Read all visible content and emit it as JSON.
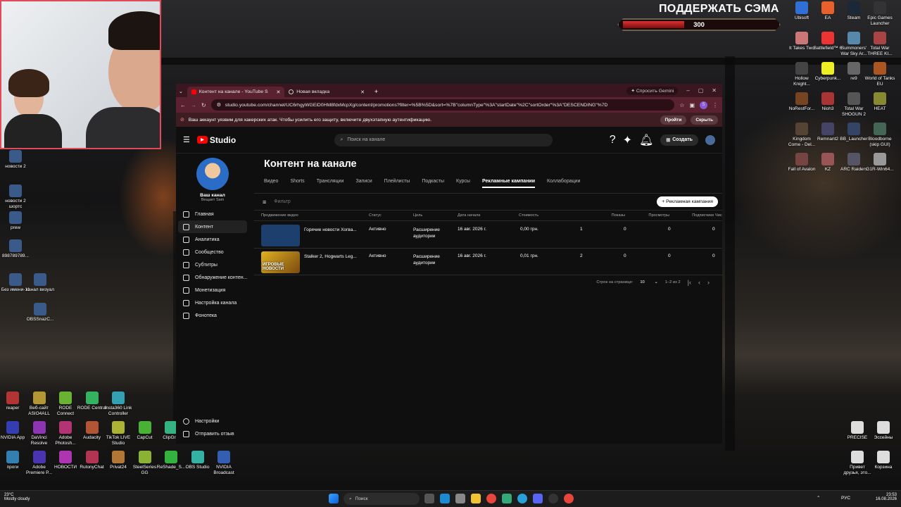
{
  "overlay": {
    "support_text": "ПОДДЕРЖАТЬ СЭМА",
    "bar_value": "300",
    "bar_fill": 0.38
  },
  "browser": {
    "tabs": [
      {
        "label": "Контент на канале - YouTube S"
      },
      {
        "label": "Новая вкладка"
      }
    ],
    "ask_gemini": "Спросить Gemini",
    "url": "studio.youtube.com/channel/UC6rhgyWGEiD0HM8fdxMcpXg/content/promotions?filter=%5B%5D&sort=%7B\"columnType\"%3A\"startDate\"%2C\"sortOrder\"%3A\"DESCENDING\"%7D",
    "profile_letter": "S",
    "warning": {
      "text": "Ваш аккаунт уязвим для хакерских атак. Чтобы усилить его защиту, включите двухэтапную аутентификацию.",
      "go": "Пройти",
      "hide": "Скрыть"
    }
  },
  "studio": {
    "logo": "Studio",
    "search_placeholder": "Поиск на канале",
    "create": "Создать",
    "channel": {
      "name": "Ваш канал",
      "handle": "Вещает Sam"
    },
    "nav": [
      "Главная",
      "Контент",
      "Аналитика",
      "Сообщество",
      "Субтитры",
      "Обнаружение контен...",
      "Монетизация",
      "Настройка канала",
      "Фонотека"
    ],
    "nav_bottom": [
      "Настройки",
      "Отправить отзыв"
    ],
    "page_title": "Контент на канале",
    "tabs": [
      "Видео",
      "Shorts",
      "Трансляции",
      "Записи",
      "Плейлисты",
      "Подкасты",
      "Курсы",
      "Рекламные кампании",
      "Коллаборации"
    ],
    "active_tab": 7,
    "filter_placeholder": "Фильтр",
    "campaign_button": "+ Рекламная кампания",
    "columns": [
      "Продвижение видео",
      "Статус",
      "Цель",
      "Дата начала",
      "Стоимость",
      "Показы",
      "Просмотры",
      "Подписчики",
      "Число последующ..."
    ],
    "rows": [
      {
        "video": "Горячие новости Хогва...",
        "status": "Активно",
        "goal": "Расширение аудитории",
        "date": "16 авг. 2026 г.",
        "cost": "0,00 грн.",
        "impr": "1",
        "views": "0",
        "subs": "0",
        "next": "0",
        "thumb": "#1d3f6e"
      },
      {
        "video": "Stalker 2, Hogwarts Leg...",
        "status": "Активно",
        "goal": "Расширение аудитории",
        "date": "16 авг. 2026 г.",
        "cost": "0,01 грн.",
        "impr": "2",
        "views": "0",
        "subs": "0",
        "next": "0",
        "thumb": "#b8860b",
        "thumb_text": "ИГРОВЫЕ НОВОСТИ"
      }
    ],
    "pager": {
      "label": "Строк на странице:",
      "size": "10",
      "range": "1–2 из 2"
    }
  },
  "desktop_icons": {
    "right": [
      {
        "label": "Ubisoft",
        "color": "#2f6fd6"
      },
      {
        "label": "EA",
        "color": "#e8612c"
      },
      {
        "label": "Steam",
        "color": "#1b2838"
      },
      {
        "label": "Epic Games Launcher",
        "color": "#333"
      },
      {
        "label": "It Takes Two",
        "color": "#c77"
      },
      {
        "label": "Battlefield™ 6",
        "color": "#e33"
      },
      {
        "label": "Summoners' War Sky Ar...",
        "color": "#58a"
      },
      {
        "label": "Total War THREE KI...",
        "color": "#a44"
      },
      {
        "label": "Hollow Knight...",
        "color": "#444"
      },
      {
        "label": "Cyberpunk...",
        "color": "#ee2"
      },
      {
        "label": "re9",
        "color": "#666"
      },
      {
        "label": "World of Tanks EU",
        "color": "#a52"
      },
      {
        "label": "NoRestFor...",
        "color": "#742"
      },
      {
        "label": "Nioh3",
        "color": "#a33"
      },
      {
        "label": "Total War SHOGUN 2",
        "color": "#555"
      },
      {
        "label": "HEAT",
        "color": "#883"
      },
      {
        "label": "Kingdom Come - Del...",
        "color": "#543"
      },
      {
        "label": "Remnant2",
        "color": "#446"
      },
      {
        "label": "BB_Launcher",
        "color": "#346"
      },
      {
        "label": "Bloodborne (skip GUI)",
        "color": "#465"
      },
      {
        "label": "Fall of Avalon",
        "color": "#744"
      },
      {
        "label": "KZ",
        "color": "#955"
      },
      {
        "label": "ARC Raiders",
        "color": "#556"
      },
      {
        "label": "G1R-Win64...",
        "color": "#999"
      }
    ],
    "left": [
      {
        "label": "новости 2"
      },
      {
        "label": "новости 2 шортс"
      },
      {
        "label": "prew"
      },
      {
        "label": "898789789..."
      },
      {
        "label": "Без имени-11"
      },
      {
        "label": "канал визуал"
      },
      {
        "label": "OBSSnazC..."
      }
    ],
    "bottom": [
      {
        "label": "reaper"
      },
      {
        "label": "Веб-сайт ASIO4ALL"
      },
      {
        "label": "RODE Connect"
      },
      {
        "label": "RODE Central"
      },
      {
        "label": "Insta360 Link Controller"
      },
      {
        "label": "NVIDIA App"
      },
      {
        "label": "DaVinci Resolve"
      },
      {
        "label": "Adobe Photosh..."
      },
      {
        "label": "Audacity"
      },
      {
        "label": "TikTok LIVE Studio"
      },
      {
        "label": "CapCut"
      },
      {
        "label": "ClipGr..."
      },
      {
        "label": "проги"
      },
      {
        "label": "Adobe Premiere P..."
      },
      {
        "label": "НОВОСТИ"
      },
      {
        "label": "RutonyChat"
      },
      {
        "label": "Privat24"
      },
      {
        "label": "SteelSeries GG"
      },
      {
        "label": "ReShade_S..."
      },
      {
        "label": "OBS Studio"
      },
      {
        "label": "NVIDIA Broadcast"
      }
    ],
    "right_bottom": [
      {
        "label": "PRECISE"
      },
      {
        "label": "Эссейны"
      },
      {
        "label": "Привет друзья, этo..."
      },
      {
        "label": "Корзина"
      }
    ]
  },
  "taskbar": {
    "weather_temp": "23°C",
    "weather_desc": "Mostly cloudy",
    "search": "Поиск",
    "lang": "РУС",
    "time": "23:53",
    "date": "16.08.2026"
  }
}
